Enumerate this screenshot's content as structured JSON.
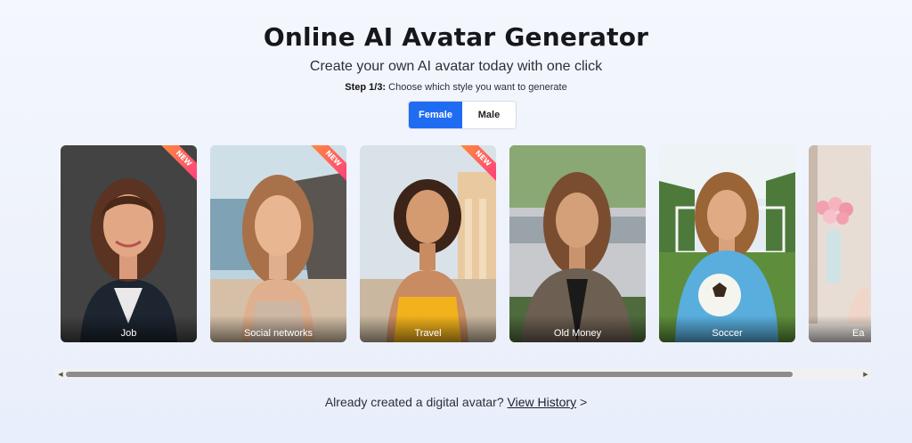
{
  "header": {
    "title": "Online AI Avatar Generator",
    "subtitle": "Create your own AI avatar today with one click",
    "step_label": "Step 1/3:",
    "step_text": " Choose which style you want to generate"
  },
  "gender_toggle": {
    "options": [
      "Female",
      "Male"
    ],
    "selected": "Female",
    "active_color": "#1f6cf2"
  },
  "styles": [
    {
      "label": "Job",
      "badge": "NEW"
    },
    {
      "label": "Social networks",
      "badge": "NEW"
    },
    {
      "label": "Travel",
      "badge": "NEW"
    },
    {
      "label": "Old Money",
      "badge": ""
    },
    {
      "label": "Soccer",
      "badge": ""
    },
    {
      "label": "Ea",
      "badge": ""
    }
  ],
  "footer": {
    "prefix": "Already created a digital avatar?",
    "link": "View History",
    "suffix": ">"
  }
}
